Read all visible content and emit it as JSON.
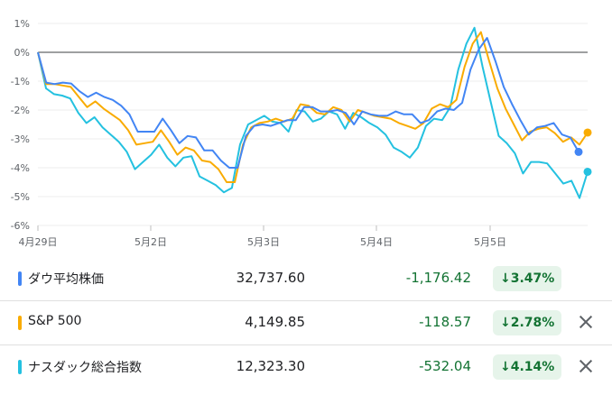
{
  "chart_data": {
    "type": "line",
    "ylim": [
      -6,
      1
    ],
    "yticks": [
      "1%",
      "0%",
      "-1%",
      "-2%",
      "-3%",
      "-4%",
      "-5%",
      "-6%"
    ],
    "xticks": [
      "4月29日",
      "5月2日",
      "5月3日",
      "5月4日",
      "5月5日"
    ],
    "series": [
      {
        "name": "ダウ平均株価",
        "color": "#4285f4",
        "values": [
          0,
          -1.05,
          -1.1,
          -1.05,
          -1.08,
          -1.35,
          -1.55,
          -1.4,
          -1.55,
          -1.65,
          -1.85,
          -2.15,
          -2.75,
          -2.75,
          -2.75,
          -2.3,
          -2.7,
          -3.15,
          -2.9,
          -2.95,
          -3.4,
          -3.4,
          -3.75,
          -4,
          -4,
          -2.9,
          -2.55,
          -2.5,
          -2.55,
          -2.45,
          -2.35,
          -2.35,
          -1.9,
          -1.9,
          -2.05,
          -2.05,
          -2,
          -2.1,
          -2.5,
          -2.05,
          -2.15,
          -2.2,
          -2.2,
          -2.05,
          -2.15,
          -2.15,
          -2.45,
          -2.35,
          -2.05,
          -1.95,
          -2,
          -1.75,
          -0.6,
          0.1,
          0.5,
          -0.3,
          -1.2,
          -1.8,
          -2.35,
          -2.85,
          -2.6,
          -2.55,
          -2.45,
          -2.85,
          -2.95,
          -3.45
        ]
      },
      {
        "name": "S&P 500",
        "color": "#f9ab00",
        "values": [
          0,
          -1.1,
          -1.1,
          -1.15,
          -1.2,
          -1.55,
          -1.9,
          -1.7,
          -1.95,
          -2.15,
          -2.35,
          -2.7,
          -3.2,
          -3.15,
          -3.1,
          -2.7,
          -3.1,
          -3.55,
          -3.3,
          -3.4,
          -3.75,
          -3.8,
          -4.05,
          -4.5,
          -4.5,
          -3.2,
          -2.6,
          -2.45,
          -2.4,
          -2.3,
          -2.4,
          -2.3,
          -1.8,
          -1.85,
          -2.1,
          -2.15,
          -1.9,
          -2,
          -2.4,
          -2.0,
          -2.1,
          -2.2,
          -2.25,
          -2.3,
          -2.45,
          -2.55,
          -2.65,
          -2.45,
          -1.95,
          -1.8,
          -1.9,
          -1.65,
          -0.5,
          0.3,
          0.7,
          -0.3,
          -1.25,
          -1.95,
          -2.5,
          -3.05,
          -2.75,
          -2.65,
          -2.6,
          -2.8,
          -3.1,
          -2.95,
          -3.2,
          -2.78
        ]
      },
      {
        "name": "ナスダック総合指数",
        "color": "#24c1e0",
        "values": [
          0,
          -1.25,
          -1.45,
          -1.5,
          -1.6,
          -2.1,
          -2.45,
          -2.25,
          -2.6,
          -2.85,
          -3.1,
          -3.45,
          -4.05,
          -3.8,
          -3.55,
          -3.2,
          -3.65,
          -3.95,
          -3.65,
          -3.6,
          -4.3,
          -4.45,
          -4.6,
          -4.85,
          -4.7,
          -3.2,
          -2.5,
          -2.35,
          -2.2,
          -2.4,
          -2.45,
          -2.75,
          -2.0,
          -2.05,
          -2.4,
          -2.3,
          -2.05,
          -2.15,
          -2.65,
          -2.1,
          -2.25,
          -2.45,
          -2.6,
          -2.85,
          -3.3,
          -3.45,
          -3.65,
          -3.3,
          -2.55,
          -2.3,
          -2.35,
          -1.9,
          -0.6,
          0.3,
          0.85,
          -0.5,
          -1.7,
          -2.9,
          -3.15,
          -3.5,
          -4.2,
          -3.8,
          -3.8,
          -3.85,
          -4.2,
          -4.55,
          -4.45,
          -5.05,
          -4.14
        ]
      }
    ]
  },
  "rows": [
    {
      "name": "ダウ平均株価",
      "price": "32,737.60",
      "change": "-1,176.42",
      "pct": "3.47%",
      "color": "#4285f4"
    },
    {
      "name": "S&P 500",
      "price": "4,149.85",
      "change": "-118.57",
      "pct": "2.78%",
      "color": "#f9ab00"
    },
    {
      "name": "ナスダック総合指数",
      "price": "12,323.30",
      "change": "-532.04",
      "pct": "4.14%",
      "color": "#24c1e0"
    }
  ],
  "icons": {
    "down_arrow": "↓",
    "close": "close-icon"
  }
}
